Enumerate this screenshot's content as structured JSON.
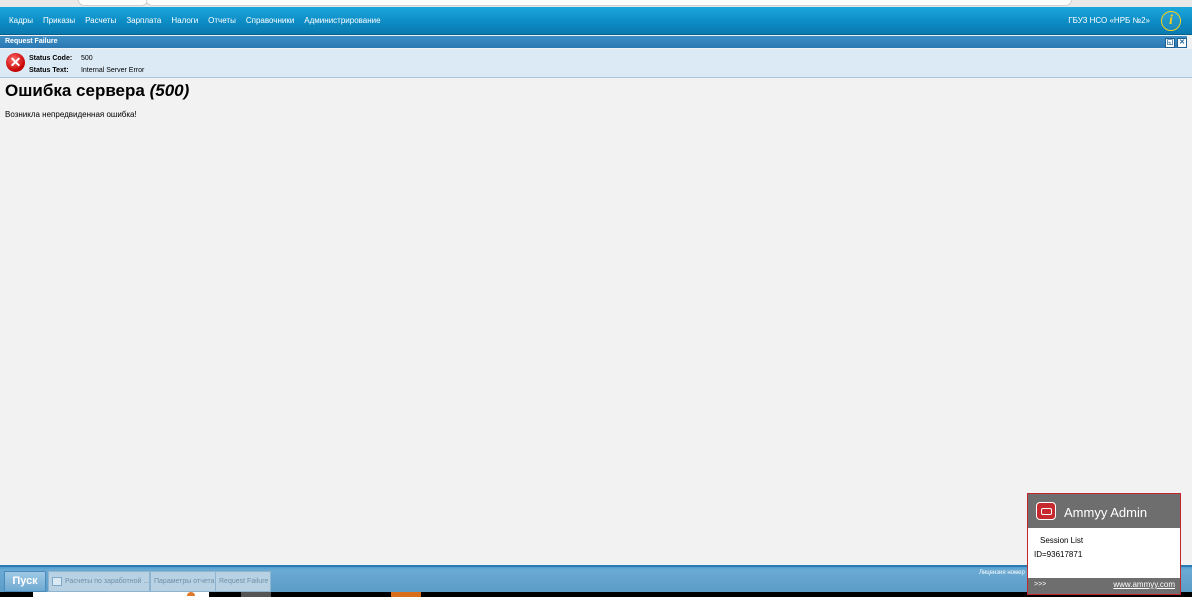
{
  "menu": {
    "items": [
      "Кадры",
      "Приказы",
      "Расчеты",
      "Зарплата",
      "Налоги",
      "Отчеты",
      "Справочники",
      "Администрирование"
    ],
    "organization": "ГБУЗ НСО «НРБ №2»"
  },
  "window": {
    "title": "Request Failure",
    "status_code_label": "Status Code:",
    "status_code_value": "500",
    "status_text_label": "Status Text:",
    "status_text_value": "Internal Server Error"
  },
  "content": {
    "heading": "Ошибка сервера",
    "heading_code": "(500)",
    "message": "Возникла непредвиденная ошибка!"
  },
  "taskbar": {
    "start_label": "Пуск",
    "tasks": [
      "Расчеты по заработной ...",
      "Параметры отчета",
      "Request Failure"
    ],
    "license_text": "Лицензия номер"
  },
  "ammyy": {
    "title": "Ammyy Admin",
    "session_list": "Session List",
    "id_text": "ID=93617871",
    "more": ">>>",
    "link": "www.ammyy.com"
  },
  "colors": {
    "menu_bar": "#0d8cc4",
    "error_icon": "#c40000",
    "ammyy_header": "#6e6e6e",
    "ammyy_border": "#c0262a"
  }
}
